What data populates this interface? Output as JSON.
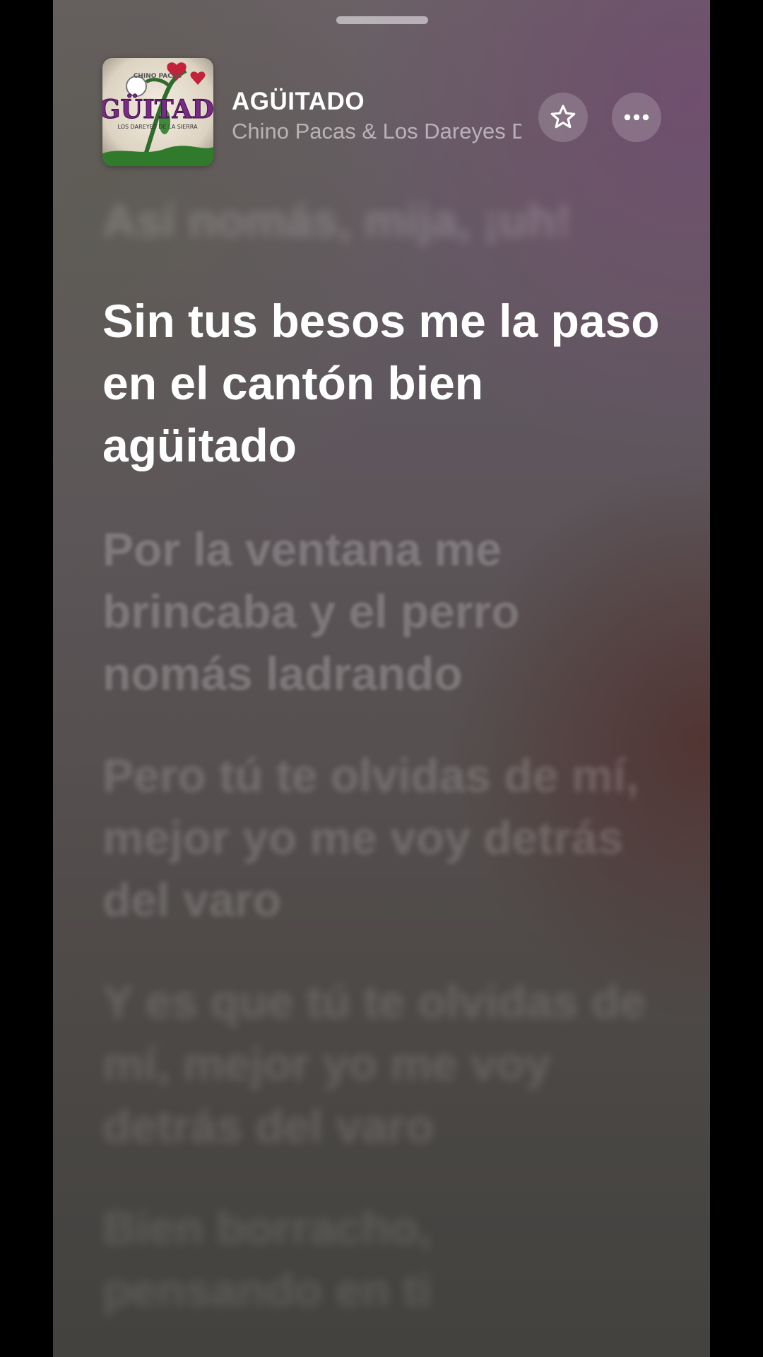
{
  "now_playing": {
    "title": "AGÜITADO",
    "artist": "Chino Pacas & Los Dareyes De La Sierra",
    "artwork_text": "AGÜITADO",
    "artwork_subtext": "LOS DAREYES DE LA SIERRA",
    "artwork_top_text": "CHINO PACAS"
  },
  "icons": {
    "favorite": "star-icon",
    "more": "ellipsis-icon"
  },
  "lyrics": {
    "previous": "Así nomás, mija, ¡uh!",
    "current": "Sin tus besos me la paso en el cantón bien agüitado",
    "upcoming": [
      "Por la ventana me brincaba y el perro nomás ladrando",
      "Pero tú te olvidas de mí, mejor yo me voy detrás del varo",
      "Y es que tú te olvidas de mí, mejor yo me voy detrás del varo",
      "Bien borracho, pensando en ti"
    ]
  },
  "colors": {
    "background_top": "#6a6166",
    "background_bottom": "#43423f",
    "accent_purple": "#6f4e6e",
    "active_lyric": "#ffffff"
  }
}
